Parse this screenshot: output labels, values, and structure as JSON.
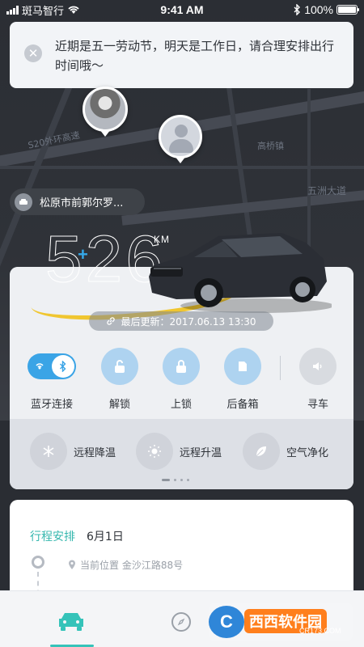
{
  "status_bar": {
    "carrier": "斑马智行",
    "time": "9:41 AM",
    "battery": "100%"
  },
  "notice": {
    "text": "近期是五一劳动节，明天是工作日，请合理安排出行时间哦～"
  },
  "map": {
    "labels": [
      "S20外环高速",
      "高桥镇",
      "五洲大道"
    ]
  },
  "location": {
    "text": "松原市前郭尔罗..."
  },
  "vehicle": {
    "mileage": "526",
    "unit": "KM",
    "update_label": "最后更新：2017.06.13  13:30"
  },
  "actions": [
    {
      "label": "蓝牙连接",
      "icon": "bluetooth-icon"
    },
    {
      "label": "解锁",
      "icon": "unlock-icon"
    },
    {
      "label": "上锁",
      "icon": "lock-icon"
    },
    {
      "label": "后备箱",
      "icon": "trunk-icon"
    },
    {
      "label": "寻车",
      "icon": "speaker-icon"
    }
  ],
  "climate": [
    {
      "label": "远程降温",
      "icon": "snowflake-icon"
    },
    {
      "label": "远程升温",
      "icon": "sun-icon"
    },
    {
      "label": "空气净化",
      "icon": "leaf-icon"
    }
  ],
  "trip": {
    "title": "行程安排",
    "date": "6月1日",
    "current_location": "当前位置  金沙江路88号"
  },
  "watermark": {
    "brand": "西西软件园",
    "domain": "CR173.COM"
  },
  "colors": {
    "accent_blue": "#3aa4e6",
    "accent_teal": "#35c3b9",
    "swoosh_yellow": "#f1c21b"
  }
}
